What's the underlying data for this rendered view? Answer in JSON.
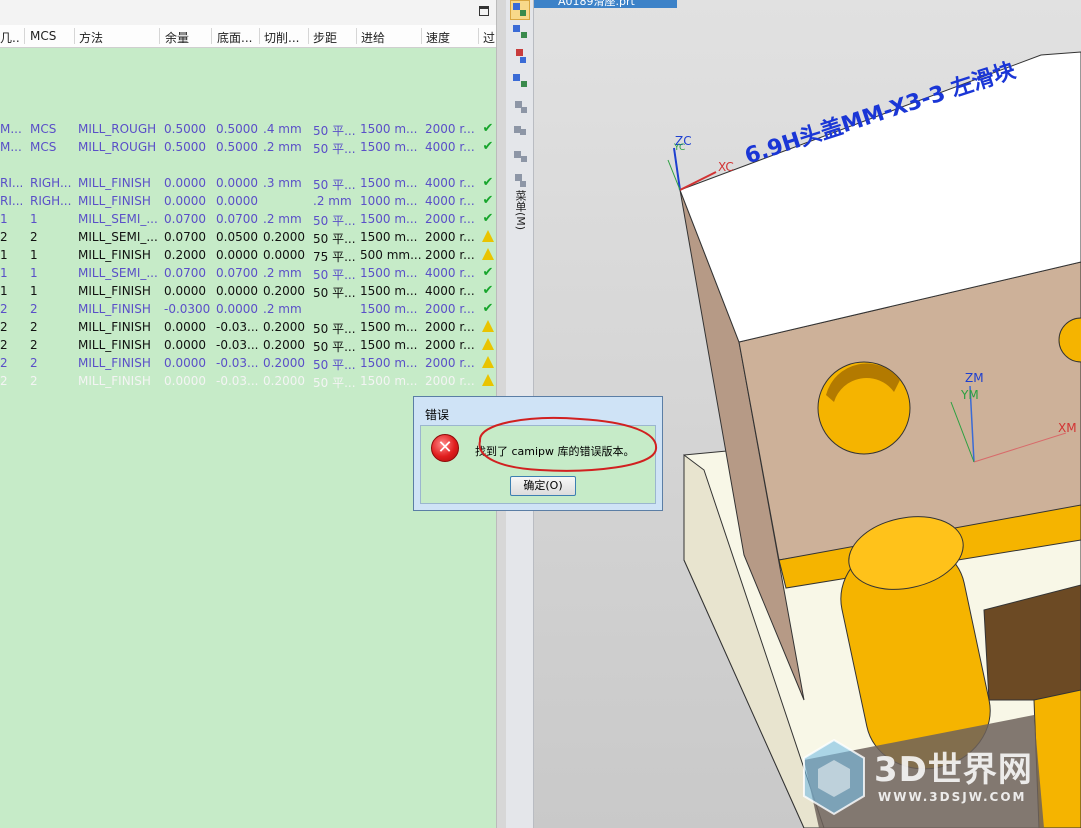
{
  "navigator": {
    "headers": [
      "几..",
      "MCS",
      "方法",
      "余量",
      "底面...",
      "切削...",
      "步距",
      "进给",
      "速度",
      "过"
    ],
    "rows": [
      {
        "style": "blue",
        "cells": [
          "M...",
          "MCS",
          "MILL_ROUGH",
          "0.5000",
          "0.5000",
          ".4 mm",
          "50 平...",
          "1500 m...",
          "2000 r..."
        ],
        "status": "check"
      },
      {
        "style": "blue",
        "cells": [
          "M...",
          "MCS",
          "MILL_ROUGH",
          "0.5000",
          "0.5000",
          ".2 mm",
          "50 平...",
          "1500 m...",
          "4000 r..."
        ],
        "status": "check"
      },
      {
        "style": "blue",
        "cells": [
          "RI...",
          "RIGH...",
          "MILL_FINISH",
          "0.0000",
          "0.0000",
          ".3 mm",
          "50 平...",
          "1500 m...",
          "4000 r..."
        ],
        "status": "check"
      },
      {
        "style": "blue",
        "cells": [
          "RI...",
          "RIGH...",
          "MILL_FINISH",
          "0.0000",
          "0.0000",
          "",
          ".2 mm",
          "1000 m...",
          "4000 r..."
        ],
        "status": "check"
      },
      {
        "style": "blue",
        "cells": [
          "1",
          "1",
          "MILL_SEMI_...",
          "0.0700",
          "0.0700",
          ".2 mm",
          "50 平...",
          "1500 m...",
          "2000 r..."
        ],
        "status": "check"
      },
      {
        "style": "black",
        "cells": [
          "2",
          "2",
          "MILL_SEMI_...",
          "0.0700",
          "0.0500",
          "0.2000",
          "50 平...",
          "1500 m...",
          "2000 r..."
        ],
        "status": "warn"
      },
      {
        "style": "black",
        "cells": [
          "1",
          "1",
          "MILL_FINISH",
          "0.2000",
          "0.0000",
          "0.0000",
          "75 平...",
          "500 mm...",
          "2000 r..."
        ],
        "status": "warn"
      },
      {
        "style": "blue",
        "cells": [
          "1",
          "1",
          "MILL_SEMI_...",
          "0.0700",
          "0.0700",
          ".2 mm",
          "50 平...",
          "1500 m...",
          "4000 r..."
        ],
        "status": "check"
      },
      {
        "style": "black",
        "cells": [
          "1",
          "1",
          "MILL_FINISH",
          "0.0000",
          "0.0000",
          "0.2000",
          "50 平...",
          "1500 m...",
          "4000 r..."
        ],
        "status": "check"
      },
      {
        "style": "blue",
        "cells": [
          "2",
          "2",
          "MILL_FINISH",
          "-0.0300",
          "0.0000",
          ".2 mm",
          "",
          "1500 m...",
          "2000 r..."
        ],
        "status": "check"
      },
      {
        "style": "black",
        "cells": [
          "2",
          "2",
          "MILL_FINISH",
          "0.0000",
          "-0.03...",
          "0.2000",
          "50 平...",
          "1500 m...",
          "2000 r..."
        ],
        "status": "warn"
      },
      {
        "style": "black",
        "cells": [
          "2",
          "2",
          "MILL_FINISH",
          "0.0000",
          "-0.03...",
          "0.2000",
          "50 平...",
          "1500 m...",
          "2000 r..."
        ],
        "status": "warn"
      },
      {
        "style": "blue",
        "cells": [
          "2",
          "2",
          "MILL_FINISH",
          "0.0000",
          "-0.03...",
          "0.2000",
          "50 平...",
          "1500 m...",
          "2000 r..."
        ],
        "status": "warn"
      },
      {
        "style": "faint",
        "cells": [
          "2",
          "2",
          "MILL_FINISH",
          "0.0000",
          "-0.03...",
          "0.2000",
          "50 平...",
          "1500 m...",
          "2000 r..."
        ],
        "status": "warn"
      }
    ]
  },
  "resource_bar": {
    "vertical_label": "菜单(M)",
    "icons": [
      "operation-navigator-icon",
      "machine-tool-icon",
      "geometry-view-icon",
      "method-view-icon",
      "part-navigator-icon",
      "history-icon",
      "reuse-library-icon",
      "roles-icon"
    ]
  },
  "viewport": {
    "doc_tab": "A0189滑座.prt",
    "part_text": "6.9H头盖MM-X3-3 左滑块",
    "wcs_labels": {
      "zc": "ZC",
      "yc": "YC",
      "xc": "XC"
    },
    "mcs_labels": {
      "zm": "ZM",
      "ym": "YM",
      "xm": "XM"
    }
  },
  "dialog": {
    "title": "错误",
    "message": "找到了 camipw 库的错误版本。",
    "ok_label": "确定(O)"
  },
  "watermark": {
    "brand": "3D世界网",
    "url": "WWW.3DSJW.COM"
  },
  "colors": {
    "navigator_bg": "#c6ebc8",
    "blue_text": "#5a4fc8",
    "part_orange": "#f5b400",
    "part_tan": "#cdb199",
    "highlight_red": "#d12020"
  }
}
